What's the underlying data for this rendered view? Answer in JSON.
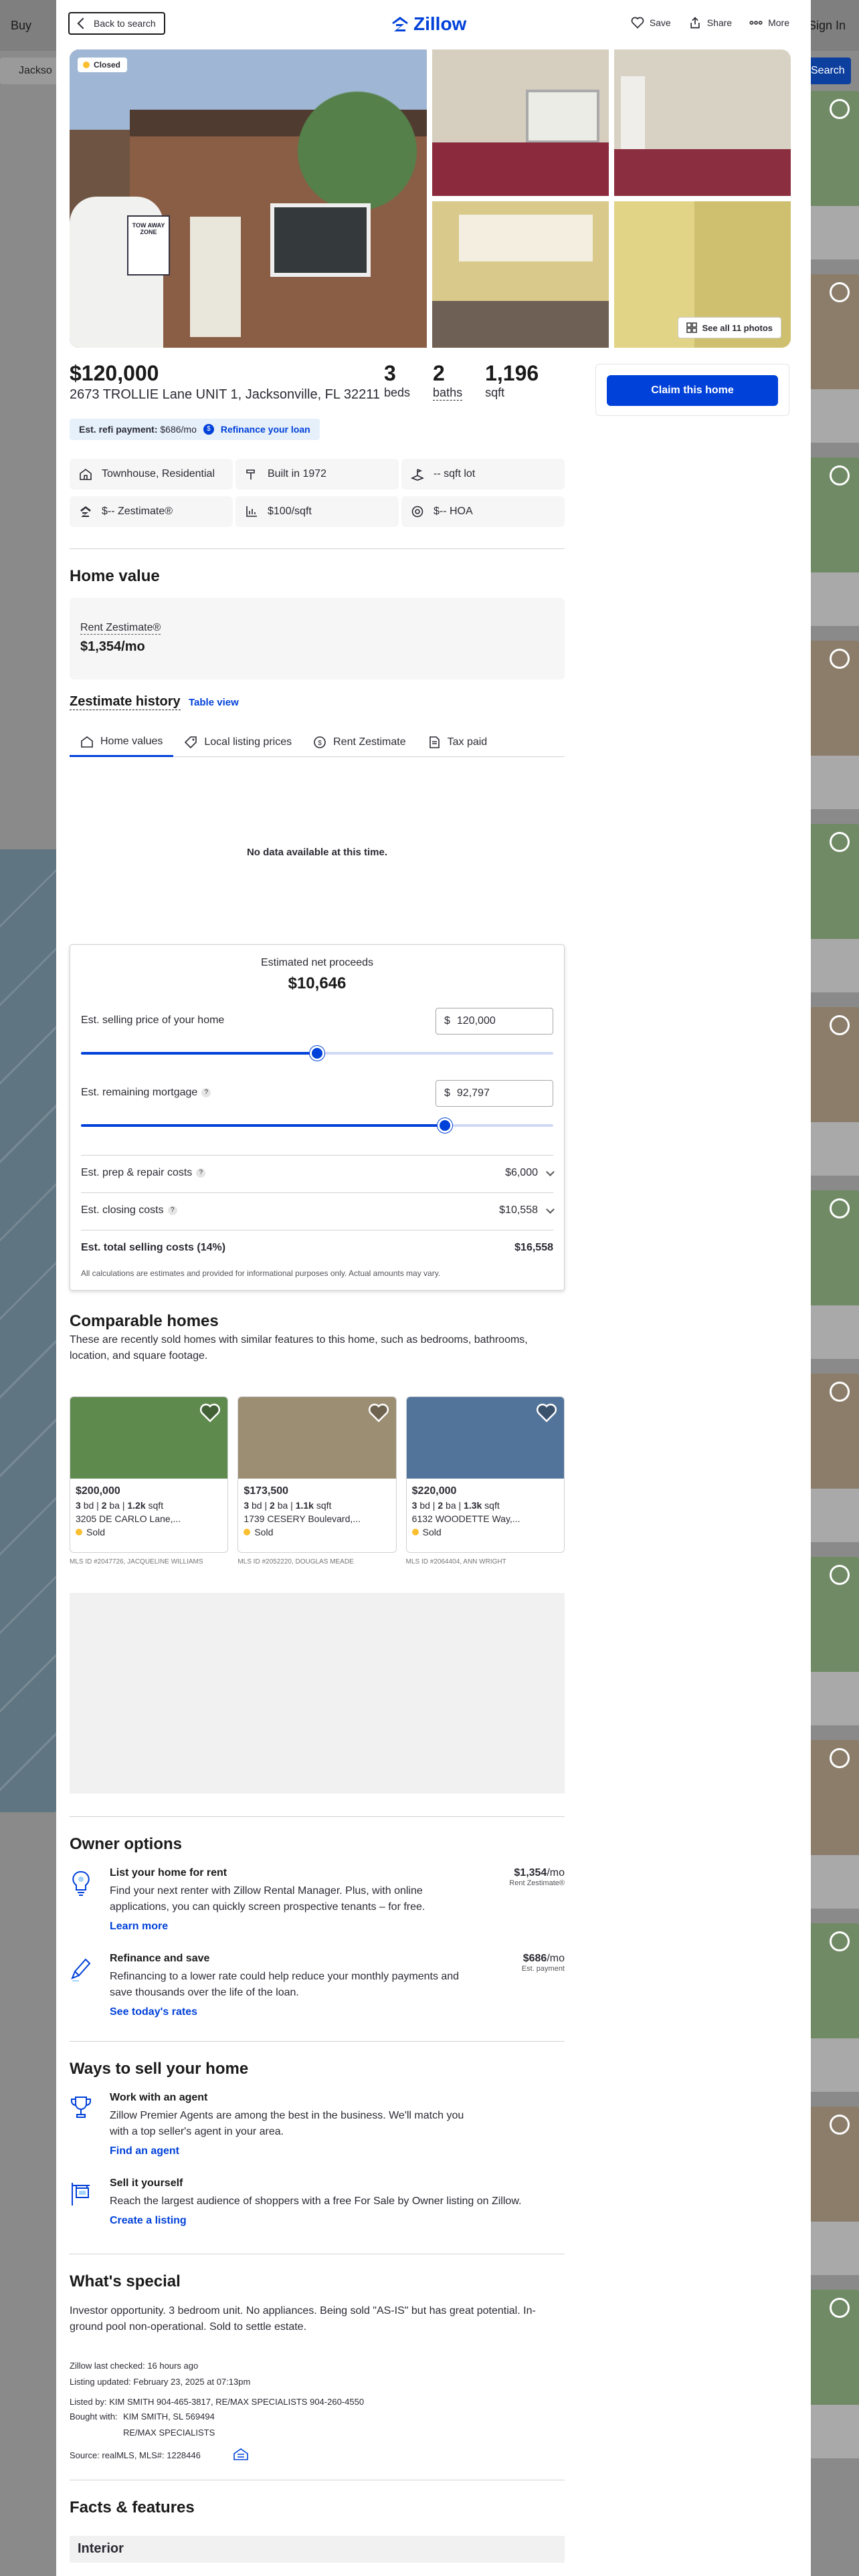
{
  "background": {
    "nav_left": "Buy",
    "nav_right": "Sign In",
    "search_value": "Jackso",
    "search_button": "Search"
  },
  "header": {
    "back_label": "Back to search",
    "logo": "Zillow",
    "save": "Save",
    "share": "Share",
    "more": "More"
  },
  "gallery": {
    "badge": "Closed",
    "sign_text": "TOW AWAY ZONE",
    "see_all": "See all 11 photos"
  },
  "summary": {
    "price": "$120,000",
    "address": "2673 TROLLIE Lane UNIT 1, Jacksonville, FL 32211",
    "beds_n": "3",
    "beds_l": "beds",
    "baths_n": "2",
    "baths_l": "baths",
    "sqft_n": "1,196",
    "sqft_l": "sqft",
    "refi_label": "Est. refi payment:",
    "refi_value": "$686/mo",
    "refi_link": "Refinance your loan",
    "claim": "Claim this home"
  },
  "facts": [
    {
      "icon": "townhouse-icon",
      "text": "Townhouse, Residential"
    },
    {
      "icon": "hammer-icon",
      "text": "Built in 1972"
    },
    {
      "icon": "lot-icon",
      "text": "-- sqft lot"
    },
    {
      "icon": "zestimate-icon",
      "text": "$-- Zestimate®"
    },
    {
      "icon": "price-sqft-icon",
      "text": "$100/sqft"
    },
    {
      "icon": "hoa-icon",
      "text": "$-- HOA"
    }
  ],
  "home_value": {
    "title": "Home value",
    "rent_label": "Rent Zestimate®",
    "rent_value": "$1,354/mo",
    "history_title": "Zestimate history",
    "table_view": "Table view",
    "tabs": [
      "Home values",
      "Local listing prices",
      "Rent Zestimate",
      "Tax paid"
    ],
    "no_data": "No data available at this time."
  },
  "net_proceeds": {
    "label": "Estimated net proceeds",
    "value": "$10,646",
    "selling_label": "Est. selling price of your home",
    "selling_currency": "$",
    "selling_value": "120,000",
    "selling_fraction": 0.5,
    "mortgage_label": "Est. remaining mortgage",
    "mortgage_currency": "$",
    "mortgage_value": "92,797",
    "mortgage_fraction": 0.77,
    "tip": "?",
    "prep_label": "Est. prep & repair costs",
    "prep_value": "$6,000",
    "closing_label": "Est. closing costs",
    "closing_value": "$10,558",
    "total_label": "Est. total selling costs (14%)",
    "total_value": "$16,558",
    "disclaimer": "All calculations are estimates and provided for informational purposes only. Actual amounts may vary."
  },
  "comparables": {
    "title": "Comparable homes",
    "subtitle": "These are recently sold homes with similar features to this home, such as bedrooms, bathrooms, location, and square footage.",
    "items": [
      {
        "price": "$200,000",
        "bd": "3",
        "ba": "2",
        "sqft": "1.2k",
        "address": "3205 DE CARLO Lane,...",
        "status": "Sold",
        "mls": "MLS ID #2047726, JACQUELINE WILLIAMS",
        "photo_color": "#5f8a4e"
      },
      {
        "price": "$173,500",
        "bd": "3",
        "ba": "2",
        "sqft": "1.1k",
        "address": "1739 CESERY Boulevard,...",
        "status": "Sold",
        "mls": "MLS ID #2052220, DOUGLAS MEADE",
        "photo_color": "#9c8e72"
      },
      {
        "price": "$220,000",
        "bd": "3",
        "ba": "2",
        "sqft": "1.3k",
        "address": "6132 WOODETTE Way,...",
        "status": "Sold",
        "mls": "MLS ID #2064404, ANN WRIGHT",
        "photo_color": "#53749a"
      }
    ],
    "bd_unit": "bd",
    "ba_unit": "ba",
    "sqft_unit": "sqft"
  },
  "owner_options": {
    "title": "Owner options",
    "rent_title": "List your home for rent",
    "rent_desc": "Find your next renter with Zillow Rental Manager. Plus, with online applications, you can quickly screen prospective tenants – for free.",
    "rent_link": "Learn more",
    "rent_amount": "$1,354",
    "rent_unit": "/mo",
    "rent_caption": "Rent Zestimate®",
    "refi_title": "Refinance and save",
    "refi_desc": "Refinancing to a lower rate could help reduce your monthly payments and save thousands over the life of the loan.",
    "refi_link": "See today's rates",
    "refi_amount": "$686",
    "refi_unit": "/mo",
    "refi_caption": "Est. payment"
  },
  "ways_to_sell": {
    "title": "Ways to sell your home",
    "agent_title": "Work with an agent",
    "agent_desc": "Zillow Premier Agents are among the best in the business. We'll match you with a top seller's agent in your area.",
    "agent_link": "Find an agent",
    "self_title": "Sell it yourself",
    "self_desc": "Reach the largest audience of shoppers with a free For Sale by Owner listing on Zillow.",
    "self_link": "Create a listing"
  },
  "special": {
    "title": "What's special",
    "desc": "Investor opportunity. 3 bedroom unit. No appliances. Being sold \"AS-IS\" but has great potential. In-ground pool non-operational. Sold to settle estate.",
    "last_checked": "Zillow last checked: 16 hours ago",
    "updated": "Listing updated: February 23, 2025 at 07:13pm",
    "listed_by": "Listed by: KIM SMITH 904-465-3817, RE/MAX SPECIALISTS 904-260-4550",
    "bought_label": "Bought with:",
    "bought_1": "KIM SMITH, SL 569494",
    "bought_2": "RE/MAX SPECIALISTS",
    "source": "Source: realMLS,  MLS#: 1228446"
  },
  "facts_features": {
    "title": "Facts & features",
    "interior": "Interior"
  }
}
